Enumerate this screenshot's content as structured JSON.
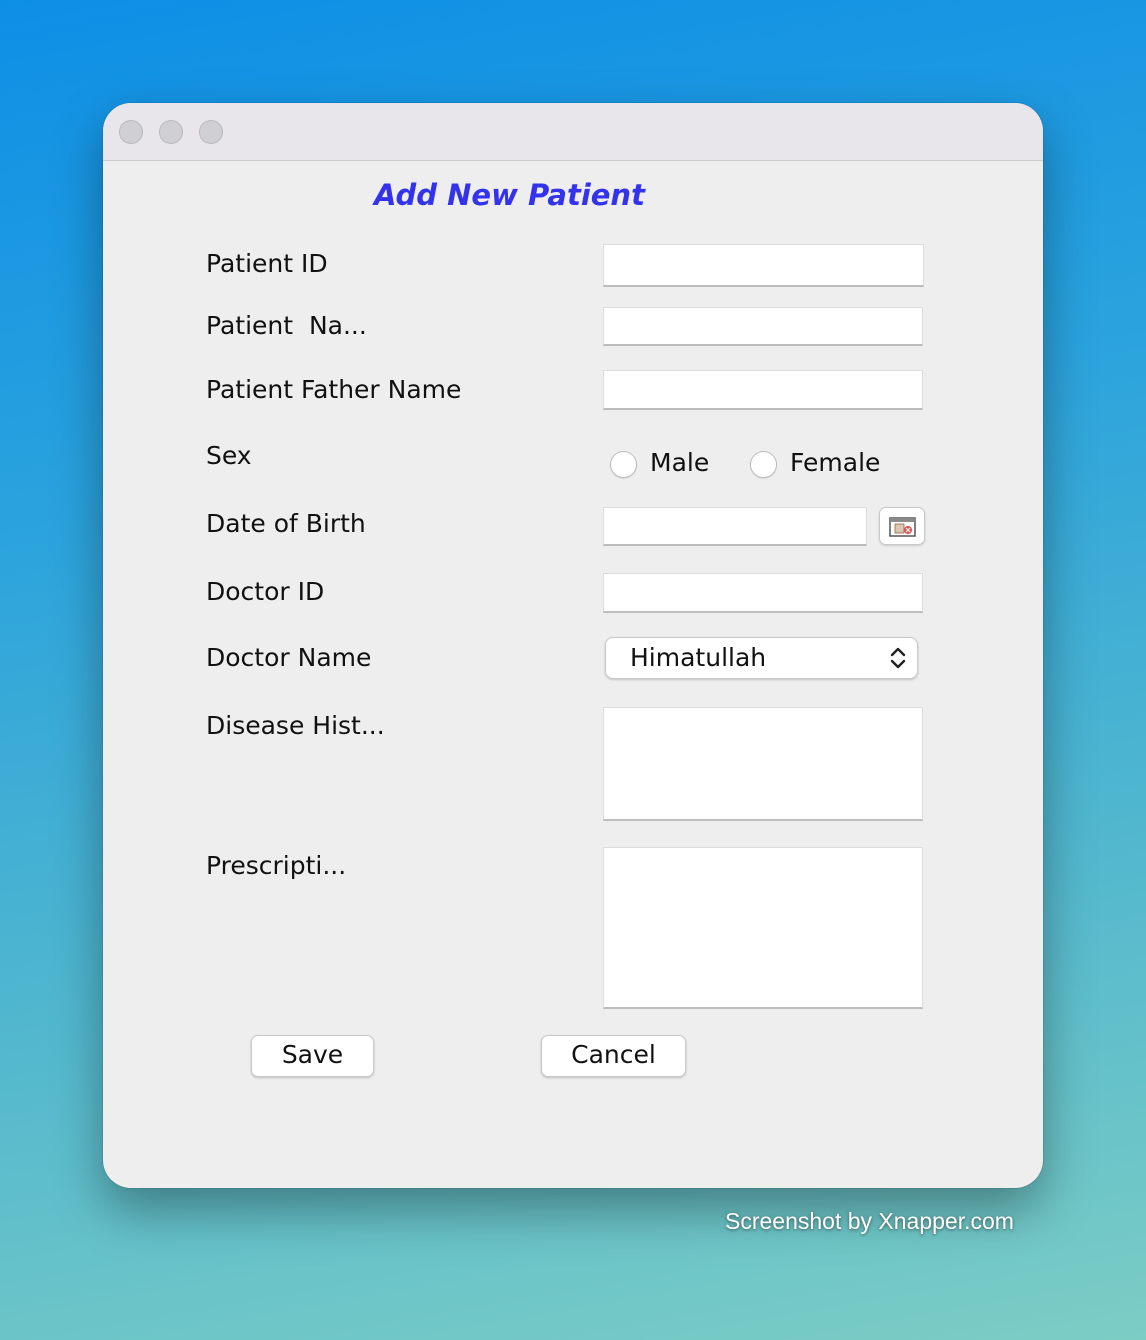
{
  "window": {
    "title": "Add New Patient"
  },
  "form": {
    "patient_id": {
      "label": "Patient ID",
      "value": ""
    },
    "patient_name": {
      "label": "Patient  Na...",
      "value": ""
    },
    "father_name": {
      "label": "Patient Father Name",
      "value": ""
    },
    "sex": {
      "label": "Sex",
      "options": [
        "Male",
        "Female"
      ],
      "selected": null
    },
    "dob": {
      "label": "Date of Birth",
      "value": "",
      "picker_icon": "calendar-icon"
    },
    "doctor_id": {
      "label": "Doctor ID",
      "value": ""
    },
    "doctor_name": {
      "label": "Doctor Name",
      "selected": "Himatullah",
      "icon": "up-down-chevron-icon"
    },
    "disease_history": {
      "label": "Disease Hist...",
      "value": ""
    },
    "prescription": {
      "label": "Prescripti...",
      "value": ""
    }
  },
  "buttons": {
    "save": "Save",
    "cancel": "Cancel"
  },
  "watermark": "Screenshot by Xnapper.com",
  "colors": {
    "title": "#3333ee",
    "window_bg": "#eeeeee"
  }
}
